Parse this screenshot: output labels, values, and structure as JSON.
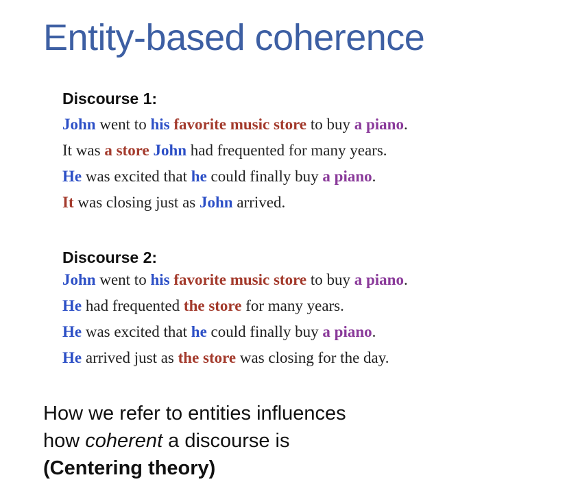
{
  "title": "Entity-based coherence",
  "colors": {
    "title": "#3d5fa3",
    "entity_john": "#2c4fc6",
    "entity_store": "#a33a2c",
    "entity_piano": "#8a3a9a"
  },
  "discourses": [
    {
      "heading": "Discourse 1:",
      "sentences": [
        [
          {
            "text": "John",
            "entity": "blue"
          },
          {
            "text": " went to ",
            "entity": "none"
          },
          {
            "text": "his",
            "entity": "blue"
          },
          {
            "text": " ",
            "entity": "none"
          },
          {
            "text": "favorite music store",
            "entity": "red"
          },
          {
            "text": " to buy ",
            "entity": "none"
          },
          {
            "text": "a piano",
            "entity": "purple"
          },
          {
            "text": ".",
            "entity": "none"
          }
        ],
        [
          {
            "text": "It was ",
            "entity": "none"
          },
          {
            "text": "a store",
            "entity": "red"
          },
          {
            "text": " ",
            "entity": "none"
          },
          {
            "text": "John",
            "entity": "blue"
          },
          {
            "text": " had frequented for many years.",
            "entity": "none"
          }
        ],
        [
          {
            "text": "He",
            "entity": "blue"
          },
          {
            "text": " was excited that ",
            "entity": "none"
          },
          {
            "text": "he",
            "entity": "blue"
          },
          {
            "text": " could finally buy ",
            "entity": "none"
          },
          {
            "text": "a piano",
            "entity": "purple"
          },
          {
            "text": ".",
            "entity": "none"
          }
        ],
        [
          {
            "text": "It",
            "entity": "red"
          },
          {
            "text": " was closing just as ",
            "entity": "none"
          },
          {
            "text": "John",
            "entity": "blue"
          },
          {
            "text": " arrived.",
            "entity": "none"
          }
        ]
      ]
    },
    {
      "heading": "Discourse 2:",
      "sentences": [
        [
          {
            "text": "John",
            "entity": "blue"
          },
          {
            "text": " went to ",
            "entity": "none"
          },
          {
            "text": "his",
            "entity": "blue"
          },
          {
            "text": " ",
            "entity": "none"
          },
          {
            "text": "favorite music store",
            "entity": "red"
          },
          {
            "text": " to buy ",
            "entity": "none"
          },
          {
            "text": "a piano",
            "entity": "purple"
          },
          {
            "text": ".",
            "entity": "none"
          }
        ],
        [
          {
            "text": "He",
            "entity": "blue"
          },
          {
            "text": " had frequented ",
            "entity": "none"
          },
          {
            "text": "the store",
            "entity": "red"
          },
          {
            "text": " for many years.",
            "entity": "none"
          }
        ],
        [
          {
            "text": "He",
            "entity": "blue"
          },
          {
            "text": " was excited that ",
            "entity": "none"
          },
          {
            "text": "he",
            "entity": "blue"
          },
          {
            "text": " could finally buy ",
            "entity": "none"
          },
          {
            "text": "a piano",
            "entity": "purple"
          },
          {
            "text": ".",
            "entity": "none"
          }
        ],
        [
          {
            "text": "He",
            "entity": "blue"
          },
          {
            "text": " arrived just as ",
            "entity": "none"
          },
          {
            "text": "the store",
            "entity": "red"
          },
          {
            "text": " was closing for the day.",
            "entity": "none"
          }
        ]
      ]
    }
  ],
  "footer": {
    "line1": "How we refer to entities influences",
    "line2_pre": "how ",
    "line2_em": "coherent",
    "line2_post": " a discourse is",
    "line3": "(Centering theory)"
  }
}
